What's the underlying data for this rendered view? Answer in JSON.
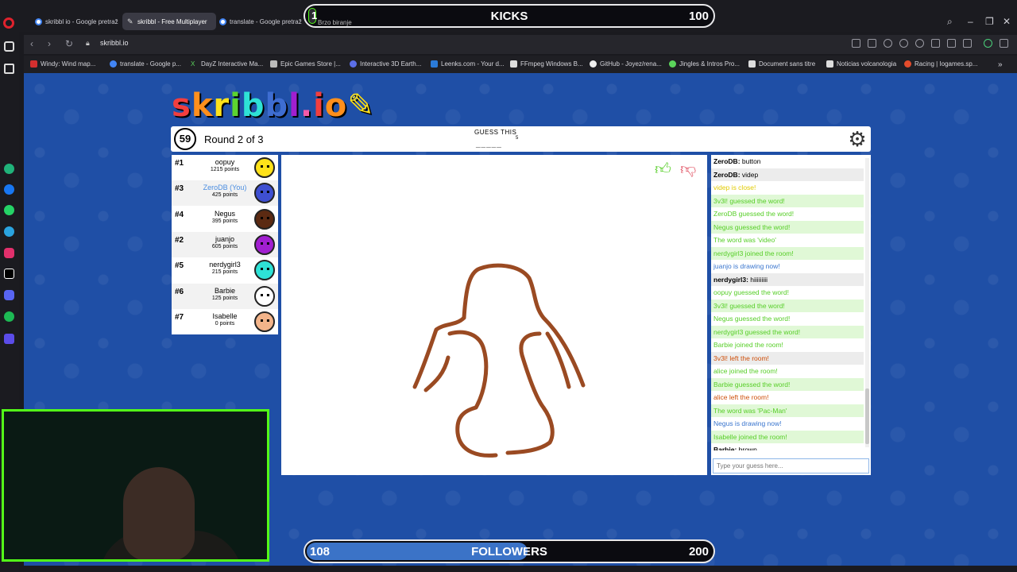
{
  "browser": {
    "tabs": [
      {
        "label": "skribbl io - Google pretraž",
        "active": false
      },
      {
        "label": "skribbl - Free Multiplayer",
        "active": true
      },
      {
        "label": "translate - Google pretraž",
        "active": false
      }
    ],
    "url": "skribbl.io",
    "bookmarks": [
      "Windy: Wind map...",
      "translate - Google p...",
      "DayZ Interactive Ma...",
      "Epic Games Store |...",
      "Interactive 3D Earth...",
      "Leenks.com - Your d...",
      "FFmpeg Windows B...",
      "GitHub - Joyez/rena...",
      "Jingles & Intros Pro...",
      "Document sans titre",
      "Noticias volcanologia",
      "Racing | Iogames.sp..."
    ]
  },
  "overlays": {
    "kicks": {
      "left_value": "1",
      "sub_label": "Brzo biranje",
      "label": "KICKS",
      "right_value": "100"
    },
    "followers": {
      "left_value": "108",
      "label": "FOLLOWERS",
      "right_value": "200",
      "progress": 0.54
    }
  },
  "game": {
    "logo": "skribbl.io",
    "timer": "59",
    "round": "Round 2 of 3",
    "hint_label": "GUESS THIS",
    "word_blanks": "_____",
    "word_length": "5",
    "players": [
      {
        "rank": "#1",
        "name": "oopuy",
        "points": "1215 points",
        "color": "#ffe21a",
        "you": false
      },
      {
        "rank": "#3",
        "name": "ZeroDB (You)",
        "points": "425 points",
        "color": "#3e4fd1",
        "you": true
      },
      {
        "rank": "#4",
        "name": "Negus",
        "points": "395 points",
        "color": "#5b2a12",
        "you": false
      },
      {
        "rank": "#2",
        "name": "juanjo",
        "points": "605 points",
        "color": "#a11fd0",
        "you": false
      },
      {
        "rank": "#5",
        "name": "nerdygirl3",
        "points": "215 points",
        "color": "#2ee2d6",
        "you": false
      },
      {
        "rank": "#6",
        "name": "Barbie",
        "points": "125 points",
        "color": "#ffffff",
        "you": false
      },
      {
        "rank": "#7",
        "name": "Isabelle",
        "points": "0 points",
        "color": "#f3b48a",
        "you": false
      }
    ],
    "chat": [
      {
        "author": "ZeroDB:",
        "text": " button",
        "style": "normal"
      },
      {
        "author": "ZeroDB:",
        "text": " videp",
        "style": "normal"
      },
      {
        "author": "",
        "text": "videp is close!",
        "style": "orange"
      },
      {
        "author": "",
        "text": "3v3l! guessed the word!",
        "style": "green"
      },
      {
        "author": "",
        "text": "ZeroDB guessed the word!",
        "style": "green"
      },
      {
        "author": "",
        "text": "Negus guessed the word!",
        "style": "green"
      },
      {
        "author": "",
        "text": "The word was 'video'",
        "style": "green"
      },
      {
        "author": "",
        "text": "nerdygirl3 joined the room!",
        "style": "green"
      },
      {
        "author": "",
        "text": "juanjo is drawing now!",
        "style": "blue"
      },
      {
        "author": "nerdygirl3:",
        "text": " hiiiiiiiii",
        "style": "normal"
      },
      {
        "author": "",
        "text": "oopuy guessed the word!",
        "style": "green"
      },
      {
        "author": "",
        "text": "3v3l! guessed the word!",
        "style": "green"
      },
      {
        "author": "",
        "text": "Negus guessed the word!",
        "style": "green"
      },
      {
        "author": "",
        "text": "nerdygirl3 guessed the word!",
        "style": "green"
      },
      {
        "author": "",
        "text": "Barbie joined the room!",
        "style": "green"
      },
      {
        "author": "",
        "text": "3v3l! left the room!",
        "style": "red"
      },
      {
        "author": "",
        "text": "alice joined the room!",
        "style": "green"
      },
      {
        "author": "",
        "text": "Barbie guessed the word!",
        "style": "green"
      },
      {
        "author": "",
        "text": "alice left the room!",
        "style": "red"
      },
      {
        "author": "",
        "text": "The word was 'Pac-Man'",
        "style": "green"
      },
      {
        "author": "",
        "text": "Negus is drawing now!",
        "style": "blue"
      },
      {
        "author": "",
        "text": "Isabelle joined the room!",
        "style": "green"
      },
      {
        "author": "Barbie:",
        "text": " brown",
        "style": "normal"
      }
    ],
    "chat_placeholder": "Type your guess here...",
    "drawing_color": "#9a4a22"
  }
}
